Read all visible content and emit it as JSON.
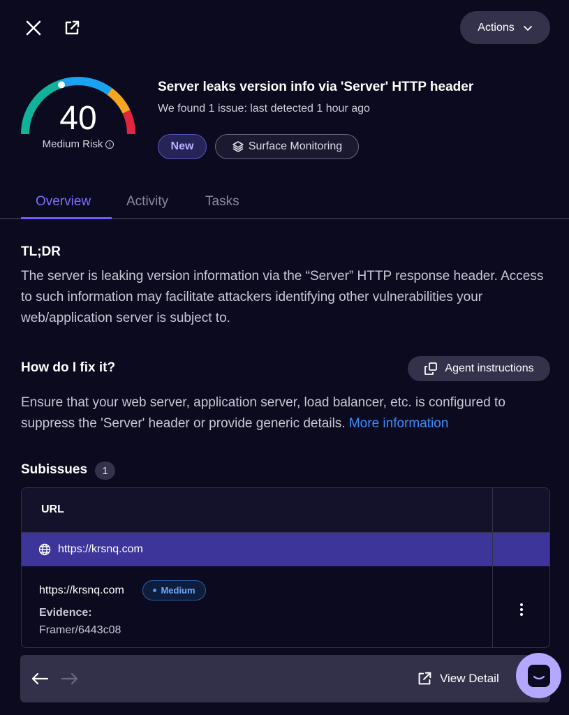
{
  "header": {
    "actions_label": "Actions"
  },
  "risk": {
    "score": "40",
    "label": "Medium Risk",
    "info_glyph": "i"
  },
  "issue": {
    "title": "Server leaks version info via 'Server' HTTP header",
    "subtitle": "We found 1 issue: last detected 1 hour ago",
    "badges": {
      "status": "New",
      "source": "Surface Monitoring"
    }
  },
  "tabs": [
    {
      "label": "Overview",
      "active": true
    },
    {
      "label": "Activity",
      "active": false
    },
    {
      "label": "Tasks",
      "active": false
    }
  ],
  "tldr": {
    "heading": "TL;DR",
    "body": "The server is leaking version information via the “Server” HTTP response header. Access to such information may facilitate attackers identifying other vulnerabilities your web/application server is subject to."
  },
  "fix": {
    "heading": "How do I fix it?",
    "agent_button": "Agent instructions",
    "body": "Ensure that your web server, application server, load balancer, etc. is configured to suppress the 'Server' header or provide generic details.",
    "link": "More information"
  },
  "subissues": {
    "heading": "Subissues",
    "count": "1",
    "column_header": "URL",
    "group_label": "https://krsnq.com",
    "row": {
      "url": "https://krsnq.com",
      "severity": "Medium",
      "evidence_label": "Evidence:",
      "evidence_value": "Framer/6443c08"
    }
  },
  "footer": {
    "view_detail": "View Detail"
  },
  "colors": {
    "background": "#0b0a1f",
    "accent": "#6a5cff",
    "group_row": "#3d3599",
    "link": "#3b8dff"
  }
}
